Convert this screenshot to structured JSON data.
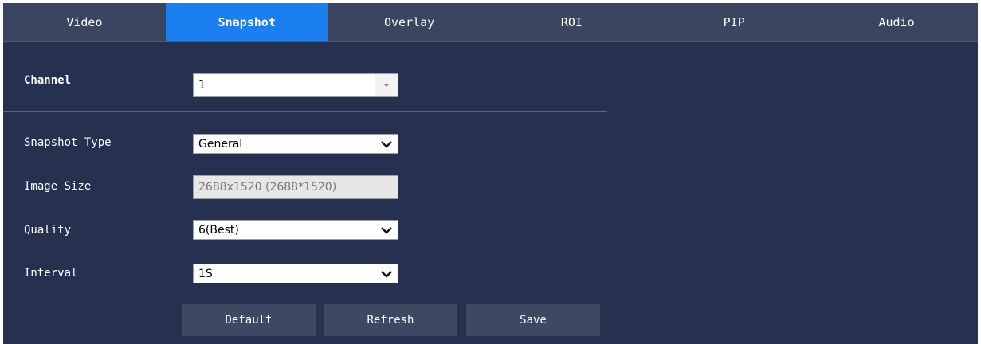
{
  "tabs": [
    {
      "label": "Video",
      "active": false
    },
    {
      "label": "Snapshot",
      "active": true
    },
    {
      "label": "Overlay",
      "active": false
    },
    {
      "label": "ROI",
      "active": false
    },
    {
      "label": "PIP",
      "active": false
    },
    {
      "label": "Audio",
      "active": false
    }
  ],
  "channel": {
    "label": "Channel",
    "value": "1",
    "icon": "combo-arrow-icon"
  },
  "form": {
    "snapshot_type": {
      "label": "Snapshot Type",
      "value": "General",
      "icon": "chevron-down-icon"
    },
    "image_size": {
      "label": "Image Size",
      "value": "2688x1520 (2688*1520)"
    },
    "quality": {
      "label": "Quality",
      "value": "6(Best)",
      "icon": "chevron-down-icon"
    },
    "interval": {
      "label": "Interval",
      "value": "1S",
      "icon": "chevron-down-icon"
    }
  },
  "buttons": {
    "default_label": "Default",
    "refresh_label": "Refresh",
    "save_label": "Save"
  },
  "colors": {
    "background": "#263150",
    "tab_bar": "#3a4560",
    "active_tab": "#1b7ff0",
    "button": "#3d4963"
  }
}
